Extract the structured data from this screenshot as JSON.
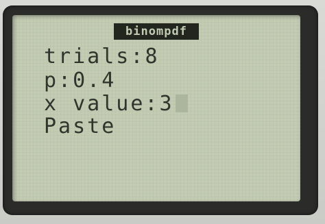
{
  "screen": {
    "title": "binompdf",
    "fields": [
      {
        "label": "trials:",
        "value": "8"
      },
      {
        "label": "p:",
        "value": "0.4"
      },
      {
        "label": "x value:",
        "value": "3"
      }
    ],
    "action": "Paste"
  },
  "colors": {
    "lcd_background": "#c3cbb3",
    "lcd_text": "#30342c",
    "bezel": "#2b2c2a"
  }
}
